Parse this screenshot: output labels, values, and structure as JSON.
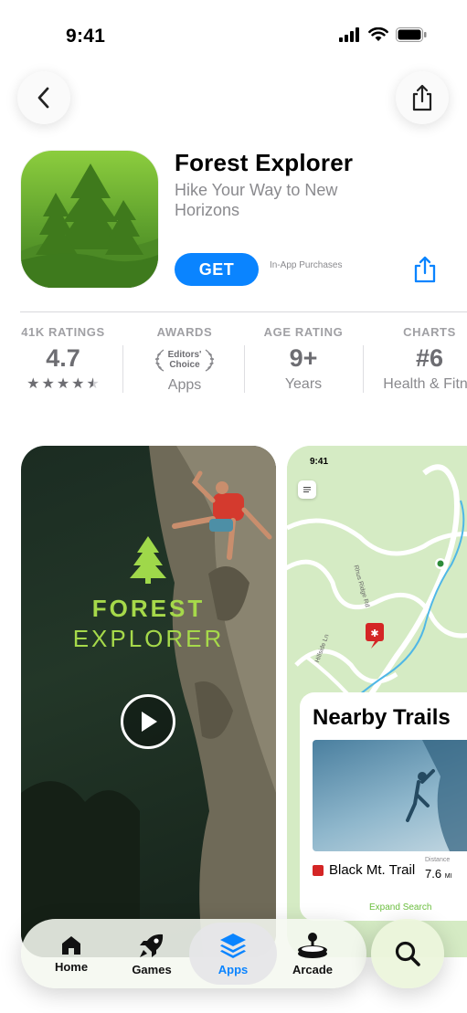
{
  "status": {
    "time": "9:41"
  },
  "app": {
    "title": "Forest Explorer",
    "subtitle": "Hike Your Way to New Horizons",
    "get_label": "GET",
    "iap_note": "In-App Purchases"
  },
  "info": {
    "ratings": {
      "head": "41K RATINGS",
      "value": "4.7",
      "stars": 4.5
    },
    "awards": {
      "head": "AWARDS",
      "badge_line1": "Editors'",
      "badge_line2": "Choice",
      "sub": "Apps"
    },
    "age": {
      "head": "AGE RATING",
      "value": "9+",
      "sub": "Years"
    },
    "charts": {
      "head": "CHARTS",
      "value": "#6",
      "sub": "Health & Fitne"
    }
  },
  "screenshot1": {
    "line1": "FOREST",
    "line2": "EXPLORER"
  },
  "screenshot2": {
    "time": "9:41",
    "map_road_1": "Rhus Ridge Rd",
    "map_road_2": "Hillside Ln",
    "card_title": "Nearby Trails",
    "trail_name": "Black Mt. Trail",
    "distance_label": "Distance",
    "distance_value": "7.6",
    "distance_unit": "MI",
    "expand": "Expand Search"
  },
  "tabbar": {
    "tabs": [
      {
        "label": "Home",
        "icon": "house-icon",
        "active": false
      },
      {
        "label": "Games",
        "icon": "rocket-icon",
        "active": false
      },
      {
        "label": "Apps",
        "icon": "layers-icon",
        "active": true
      },
      {
        "label": "Arcade",
        "icon": "joystick-icon",
        "active": false
      }
    ],
    "search_icon": "search-icon"
  },
  "colors": {
    "accent": "#0a84ff",
    "forest_green": "#5fa12d",
    "lime": "#a6d94a"
  }
}
